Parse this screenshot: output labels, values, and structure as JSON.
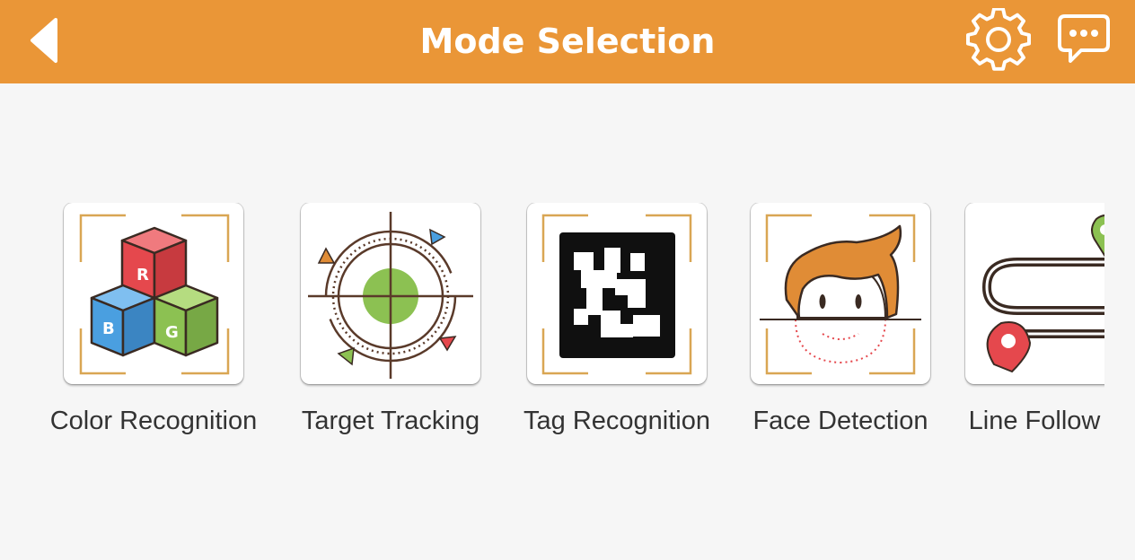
{
  "header": {
    "title": "Mode Selection",
    "background_color": "#ea9637",
    "icons": [
      "back-arrow-icon",
      "settings-gear-icon",
      "chat-bubble-icon"
    ]
  },
  "modes": [
    {
      "label": "Color Recognition",
      "icon": "color-cubes-icon"
    },
    {
      "label": "Target Tracking",
      "icon": "target-crosshair-icon"
    },
    {
      "label": "Tag Recognition",
      "icon": "qr-tag-icon"
    },
    {
      "label": "Face Detection",
      "icon": "face-scan-icon"
    },
    {
      "label": "Line Follow",
      "icon": "route-path-icon"
    }
  ],
  "colors": {
    "red": "#e5484d",
    "blue": "#4a9fe0",
    "green": "#8cc152",
    "orange": "#e08c36",
    "frame": "#d9a653"
  }
}
